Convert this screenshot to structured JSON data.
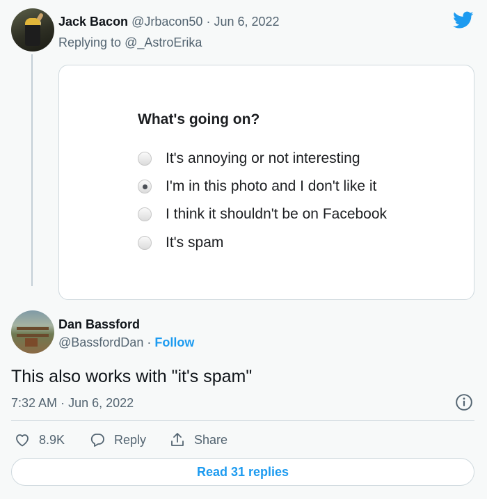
{
  "parent_tweet": {
    "author_name": "Jack Bacon",
    "author_handle": "@Jrbacon50",
    "separator": "·",
    "date": "Jun 6, 2022",
    "replying_prefix": "Replying to",
    "replying_to": "@_AstroErika"
  },
  "embedded_image": {
    "question": "What's going on?",
    "options": [
      {
        "label": "It's annoying or not interesting",
        "checked": false
      },
      {
        "label": "I'm in this photo and I don't like it",
        "checked": true
      },
      {
        "label": "I think it shouldn't be on Facebook",
        "checked": false
      },
      {
        "label": "It's spam",
        "checked": false
      }
    ]
  },
  "main_tweet": {
    "author_name": "Dan Bassford",
    "author_handle": "@BassfordDan",
    "separator": "·",
    "follow_label": "Follow",
    "text": "This also works with \"it's spam\"",
    "time": "7:32 AM",
    "date": "Jun 6, 2022"
  },
  "actions": {
    "like_count": "8.9K",
    "reply_label": "Reply",
    "share_label": "Share"
  },
  "read_replies_label": "Read 31 replies",
  "colors": {
    "accent": "#1d9bf0",
    "text": "#0f1419",
    "muted": "#536471",
    "border": "#cfd9de"
  },
  "icons": [
    "twitter-logo-icon",
    "info-icon",
    "heart-icon",
    "reply-bubble-icon",
    "share-icon"
  ]
}
